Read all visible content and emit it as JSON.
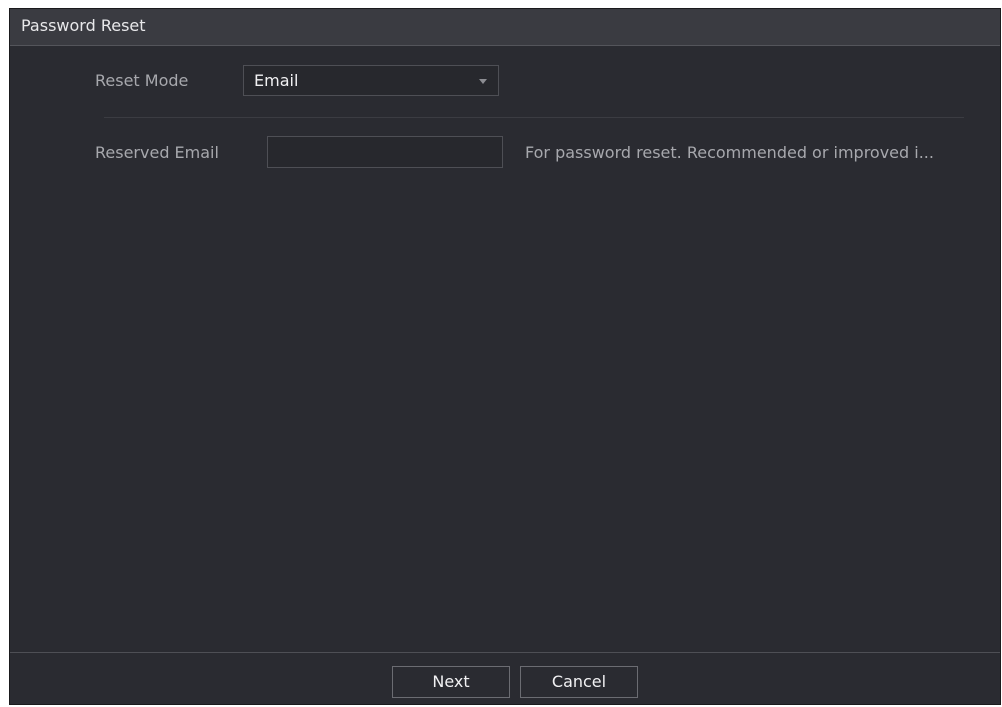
{
  "dialog": {
    "title": "Password Reset"
  },
  "form": {
    "reset_mode_label": "Reset Mode",
    "reset_mode_value": "Email",
    "reserved_email_label": "Reserved Email",
    "reserved_email_value": "",
    "reserved_email_hint": "For password reset. Recommended or improved i..."
  },
  "footer": {
    "next_label": "Next",
    "cancel_label": "Cancel"
  },
  "colors": {
    "dialog_bg": "#2a2b31",
    "titlebar_bg": "#3a3b41",
    "label_text": "#a7a8ad",
    "value_text": "#f1f1f3"
  },
  "icons": {
    "dropdown": "caret-down-icon"
  }
}
